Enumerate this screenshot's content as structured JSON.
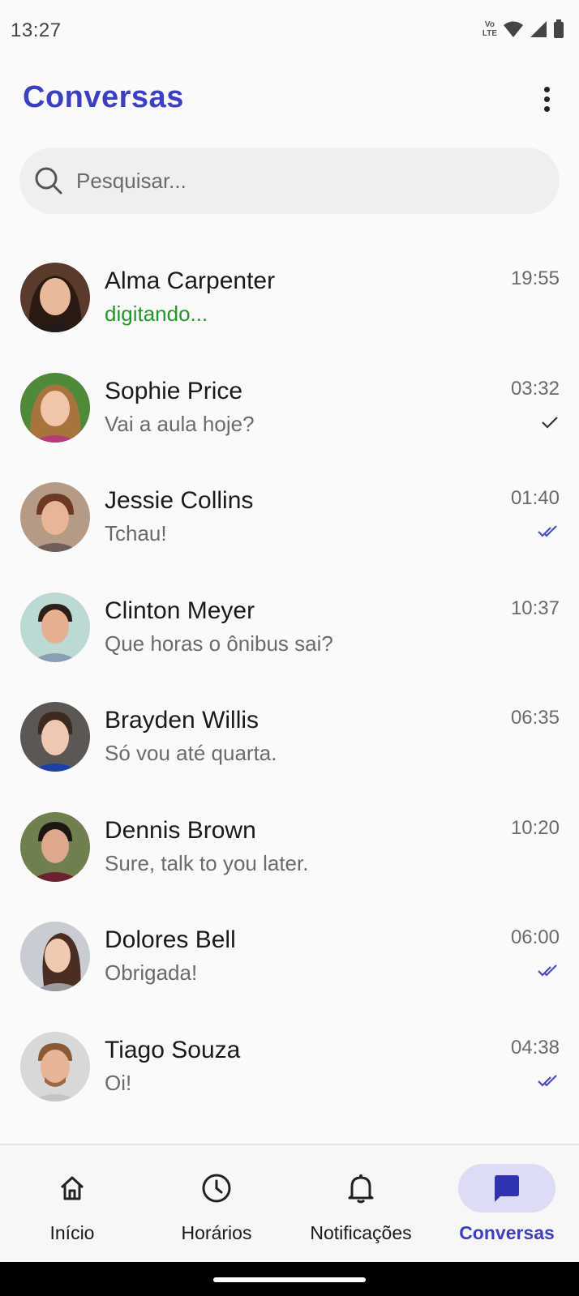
{
  "status_bar": {
    "time": "13:27",
    "volte_top": "Vo",
    "volte_bottom": "LTE",
    "icons": [
      "volte-lte-icon",
      "wifi-icon",
      "cellular-signal-icon",
      "battery-icon"
    ]
  },
  "header": {
    "title": "Conversas",
    "menu_icon": "more-vert-icon"
  },
  "search": {
    "placeholder": "Pesquisar...",
    "value": "",
    "icon": "search-icon"
  },
  "colors": {
    "accent": "#3c3fc0",
    "typing": "#22962a",
    "read_receipt": "#4a4dbf",
    "sent_receipt": "#333333",
    "nav_active_bg": "#dcdcf4"
  },
  "chats": [
    {
      "name": "Alma Carpenter",
      "message": "digitando...",
      "time": "19:55",
      "status": "none",
      "typing": true
    },
    {
      "name": "Sophie Price",
      "message": "Vai a aula hoje?",
      "time": "03:32",
      "status": "sent",
      "typing": false
    },
    {
      "name": "Jessie Collins",
      "message": "Tchau!",
      "time": "01:40",
      "status": "read",
      "typing": false
    },
    {
      "name": "Clinton Meyer",
      "message": "Que horas o ônibus sai?",
      "time": "10:37",
      "status": "none",
      "typing": false
    },
    {
      "name": "Brayden Willis",
      "message": "Só vou até quarta.",
      "time": "06:35",
      "status": "none",
      "typing": false
    },
    {
      "name": "Dennis Brown",
      "message": "Sure, talk to you later.",
      "time": "10:20",
      "status": "none",
      "typing": false
    },
    {
      "name": "Dolores Bell",
      "message": "Obrigada!",
      "time": "06:00",
      "status": "read",
      "typing": false
    },
    {
      "name": "Tiago Souza",
      "message": "Oi!",
      "time": "04:38",
      "status": "read",
      "typing": false
    }
  ],
  "bottom_nav": {
    "items": [
      {
        "label": "Início",
        "icon": "home-icon",
        "active": false
      },
      {
        "label": "Horários",
        "icon": "clock-icon",
        "active": false
      },
      {
        "label": "Notificações",
        "icon": "bell-icon",
        "active": false
      },
      {
        "label": "Conversas",
        "icon": "chat-bubble-icon",
        "active": true
      }
    ]
  }
}
